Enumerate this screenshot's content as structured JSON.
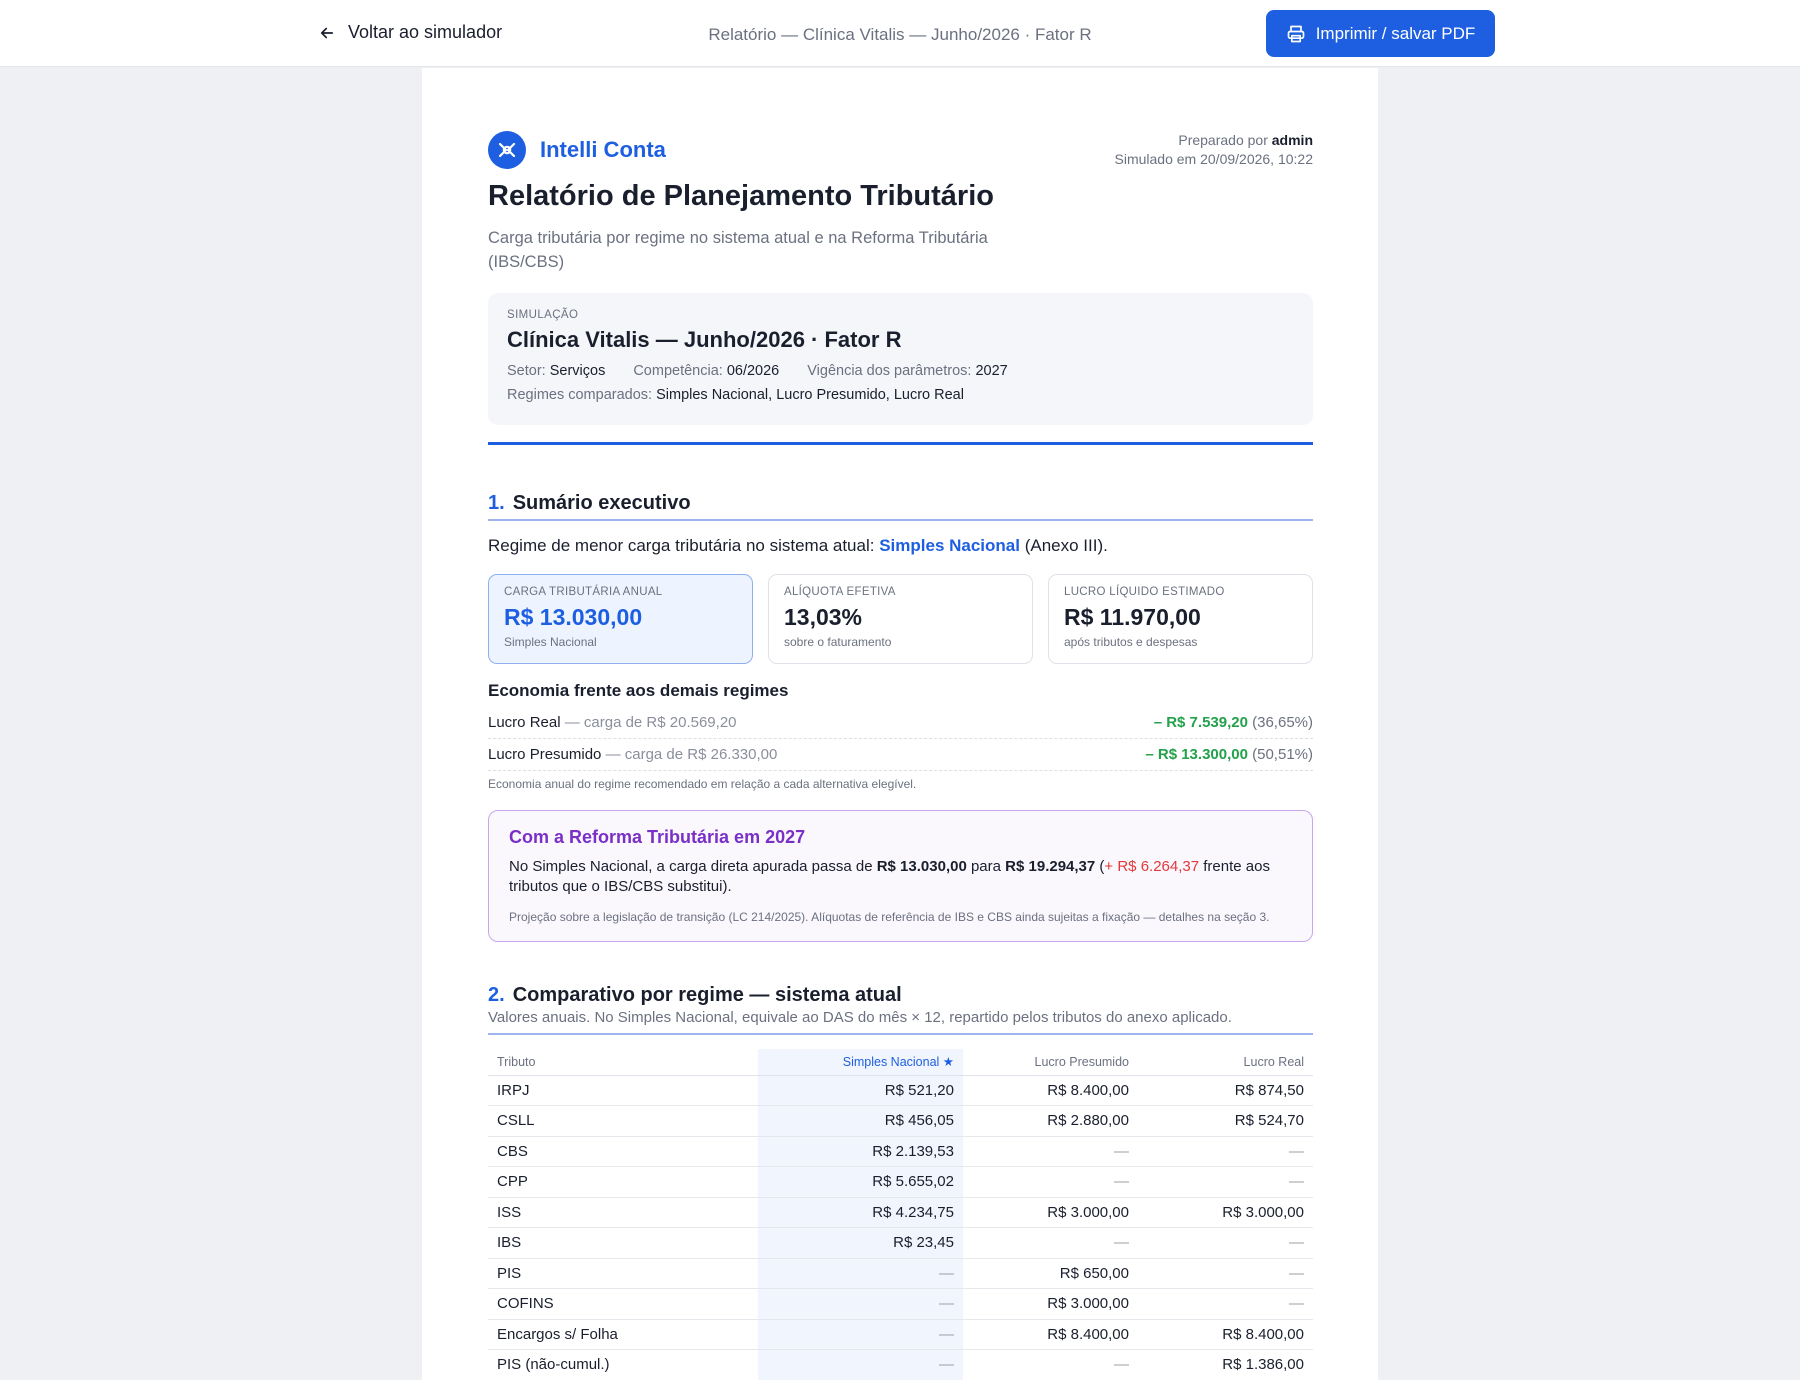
{
  "topbar": {
    "back_label": "Voltar ao simulador",
    "title": "Relatório — Clínica Vitalis — Junho/2026 · Fator R",
    "print_label": "Imprimir / salvar PDF"
  },
  "brand": {
    "name": "Intelli Conta"
  },
  "prepared": {
    "by_label": "Preparado por",
    "by_user": "admin",
    "simulated": "Simulado em 20/09/2026, 10:22"
  },
  "report": {
    "title": "Relatório de Planejamento Tributário",
    "subtitle": "Carga tributária por regime no sistema atual e na Reforma Tributária (IBS/CBS)"
  },
  "simulation": {
    "label": "SIMULAÇÃO",
    "name": "Clínica Vitalis — Junho/2026 · Fator R",
    "setor_label": "Setor:",
    "setor": "Serviços",
    "competencia_label": "Competência:",
    "competencia": "06/2026",
    "vigencia_label": "Vigência dos parâmetros:",
    "vigencia": "2027",
    "regimes_label": "Regimes comparados:",
    "regimes": "Simples Nacional, Lucro Presumido, Lucro Real"
  },
  "section1": {
    "num": "1.",
    "title": "Sumário executivo",
    "best_prefix": "Regime de menor carga tributária no sistema atual:",
    "best_regime": "Simples Nacional",
    "best_suffix": "(Anexo III).",
    "kpis": [
      {
        "label": "CARGA TRIBUTÁRIA ANUAL",
        "value": "R$ 13.030,00",
        "sub": "Simples Nacional"
      },
      {
        "label": "ALÍQUOTA EFETIVA",
        "value": "13,03%",
        "sub": "sobre o faturamento"
      },
      {
        "label": "LUCRO LÍQUIDO ESTIMADO",
        "value": "R$ 11.970,00",
        "sub": "após tributos e despesas"
      }
    ],
    "economy_title": "Economia frente aos demais regimes",
    "economy": [
      {
        "regime": "Lucro Real",
        "carga": "— carga de R$ 20.569,20",
        "saving": "– R$ 7.539,20",
        "pct": "(36,65%)"
      },
      {
        "regime": "Lucro Presumido",
        "carga": "— carga de R$ 26.330,00",
        "saving": "– R$ 13.300,00",
        "pct": "(50,51%)"
      }
    ],
    "economy_note": "Economia anual do regime recomendado em relação a cada alternativa elegível.",
    "reform": {
      "title": "Com a Reforma Tributária em 2027",
      "t1": "No Simples Nacional, a carga direta apurada passa de",
      "from": "R$ 13.030,00",
      "t2": "para",
      "to": "R$ 19.294,37",
      "open": "(",
      "delta": "+ R$ 6.264,37",
      "t3": "frente aos tributos que o IBS/CBS substitui).",
      "note": "Projeção sobre a legislação de transição (LC 214/2025). Alíquotas de referência de IBS e CBS ainda sujeitas a fixação — detalhes na seção 3."
    }
  },
  "section2": {
    "num": "2.",
    "title": "Comparativo por regime — sistema atual",
    "subtitle": "Valores anuais. No Simples Nacional, equivale ao DAS do mês × 12, repartido pelos tributos do anexo aplicado.",
    "headers": {
      "tributo": "Tributo",
      "sn": "Simples Nacional ★",
      "lp": "Lucro Presumido",
      "lr": "Lucro Real"
    },
    "rows": [
      {
        "tributo": "IRPJ",
        "sn": "R$ 521,20",
        "lp": "R$ 8.400,00",
        "lr": "R$ 874,50"
      },
      {
        "tributo": "CSLL",
        "sn": "R$ 456,05",
        "lp": "R$ 2.880,00",
        "lr": "R$ 524,70"
      },
      {
        "tributo": "CBS",
        "sn": "R$ 2.139,53",
        "lp": "—",
        "lr": "—"
      },
      {
        "tributo": "CPP",
        "sn": "R$ 5.655,02",
        "lp": "—",
        "lr": "—"
      },
      {
        "tributo": "ISS",
        "sn": "R$ 4.234,75",
        "lp": "R$ 3.000,00",
        "lr": "R$ 3.000,00"
      },
      {
        "tributo": "IBS",
        "sn": "R$ 23,45",
        "lp": "—",
        "lr": "—"
      },
      {
        "tributo": "PIS",
        "sn": "—",
        "lp": "R$ 650,00",
        "lr": "—"
      },
      {
        "tributo": "COFINS",
        "sn": "—",
        "lp": "R$ 3.000,00",
        "lr": "—"
      },
      {
        "tributo": "Encargos s/ Folha",
        "sn": "—",
        "lp": "R$ 8.400,00",
        "lr": "R$ 8.400,00"
      },
      {
        "tributo": "PIS (não-cumul.)",
        "sn": "—",
        "lp": "—",
        "lr": "R$ 1.386,00"
      }
    ]
  }
}
